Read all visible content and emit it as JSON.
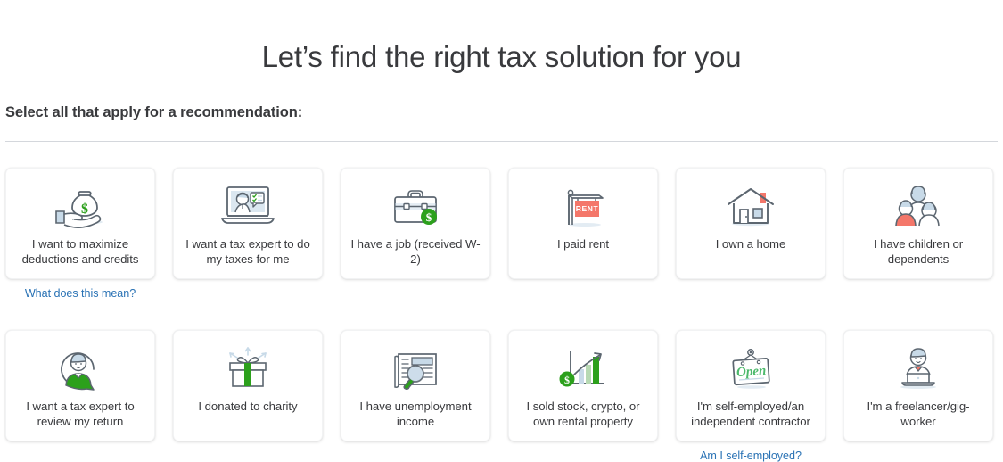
{
  "header": {
    "title": "Let’s find the right tax solution for you",
    "subtitle": "Select all that apply for a recommendation:"
  },
  "colors": {
    "text": "#393a3d",
    "link": "#2b73b5",
    "accent_green": "#2ca01c",
    "accent_salmon": "#f4776a",
    "icon_outline": "#5c6670",
    "icon_fill_blue": "#c8dae8",
    "card_bg": "#ffffff",
    "divider": "#d4d7dc"
  },
  "cards": [
    {
      "id": "maximize-deductions",
      "label": "I want to maximize deductions and credits",
      "icon": "money-bag-in-hand-icon",
      "help_link": "What does this mean?"
    },
    {
      "id": "expert-do-taxes",
      "label": "I want a tax expert to do my taxes for me",
      "icon": "laptop-expert-video-icon",
      "help_link": null
    },
    {
      "id": "have-a-job",
      "label": "I have a job (received W-2)",
      "icon": "briefcase-dollar-icon",
      "help_link": null
    },
    {
      "id": "paid-rent",
      "label": "I paid rent",
      "icon": "rent-sign-icon",
      "help_link": null
    },
    {
      "id": "own-a-home",
      "label": "I own a home",
      "icon": "house-icon",
      "help_link": null
    },
    {
      "id": "children-dependents",
      "label": "I have children or dependents",
      "icon": "family-group-icon",
      "help_link": null
    },
    {
      "id": "expert-review-return",
      "label": "I want a tax expert to review my return",
      "icon": "expert-chat-bubble-icon",
      "help_link": null
    },
    {
      "id": "donated-charity",
      "label": "I donated to charity",
      "icon": "gift-box-icon",
      "help_link": null
    },
    {
      "id": "unemployment-income",
      "label": "I have unemployment income",
      "icon": "newspaper-magnifier-icon",
      "help_link": null
    },
    {
      "id": "sold-stock-crypto-rental",
      "label": "I sold stock, crypto, or own rental property",
      "icon": "growth-chart-dollar-icon",
      "help_link": null
    },
    {
      "id": "self-employed-contractor",
      "label": "I'm self-employed/an independent contractor",
      "icon": "open-sign-icon",
      "help_link": "Am I self-employed?"
    },
    {
      "id": "freelancer-gig-worker",
      "label": "I'm a freelancer/gig-worker",
      "icon": "person-laptop-icon",
      "help_link": null
    }
  ]
}
